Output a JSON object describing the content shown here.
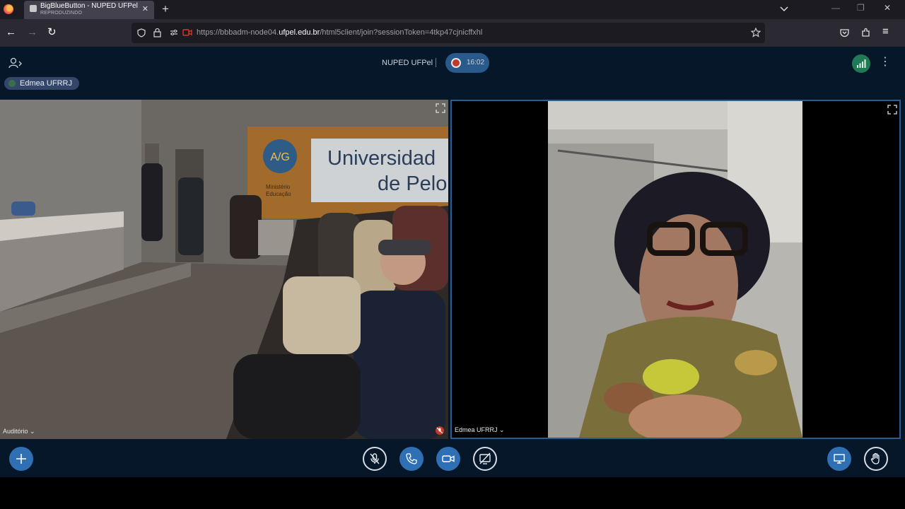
{
  "browser": {
    "tab": {
      "title": "BigBlueButton - NUPED UFPel",
      "subtitle": "REPRODUZINDO"
    },
    "url": {
      "prefix": "https://bbbadm-node04.",
      "domain": "ufpel.edu.br",
      "path": "/html5client/join?sessionToken=4tkp47cjnicffxhl"
    }
  },
  "app": {
    "header": {
      "meeting_name": "NUPED UFPel",
      "recording_time": "16:02"
    },
    "talking_indicator": {
      "name": "Edmea UFRRJ"
    },
    "videos": [
      {
        "label": "Auditório",
        "muted": true
      },
      {
        "label": "Edmea UFRRJ",
        "talking": true
      }
    ],
    "actions": [
      "plus-icon",
      "microphone-off-icon",
      "phone-icon",
      "camera-icon",
      "screenshare-off-icon",
      "presentation-icon",
      "raise-hand-icon"
    ]
  },
  "scene": {
    "sign_line1": "Universidad",
    "sign_line2": "de Pelo",
    "logo_text": "A/G",
    "ministry_line1": "Ministério",
    "ministry_line2": "Educação"
  },
  "colors": {
    "app_background": "#06172a",
    "accent_blue": "#2f6fb4",
    "connection_green": "#1f7a56"
  }
}
